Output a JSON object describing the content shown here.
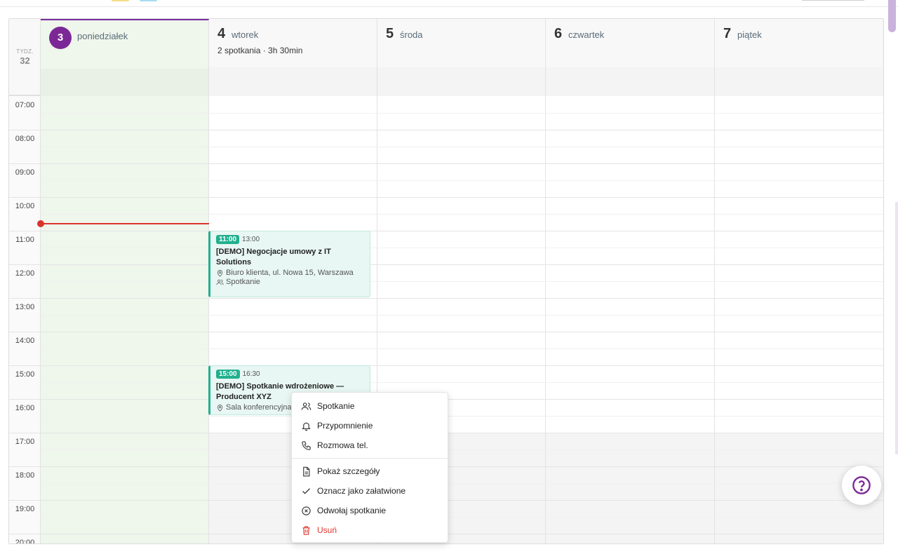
{
  "week": {
    "label": "TYDZ.",
    "number": "32"
  },
  "days": [
    {
      "num": "3",
      "name": "poniedziałek",
      "summary": ""
    },
    {
      "num": "4",
      "name": "wtorek",
      "summary": "2 spotkania · 3h 30min"
    },
    {
      "num": "5",
      "name": "środa",
      "summary": ""
    },
    {
      "num": "6",
      "name": "czwartek",
      "summary": ""
    },
    {
      "num": "7",
      "name": "piątek",
      "summary": ""
    }
  ],
  "times": [
    "07:00",
    "08:00",
    "09:00",
    "10:00",
    "11:00",
    "12:00",
    "13:00",
    "14:00",
    "15:00",
    "16:00",
    "17:00",
    "18:00",
    "19:00",
    "20:00"
  ],
  "events": [
    {
      "start": "11:00",
      "end": "13:00",
      "title": "[DEMO] Negocjacje umowy z IT Solutions",
      "location": "Biuro klienta, ul. Nowa 15, Warszawa",
      "type": "Spotkanie"
    },
    {
      "start": "15:00",
      "end": "16:30",
      "title": "[DEMO] Spotkanie wdrożeniowe — Producent XYZ",
      "location": "Sala konferencyjna"
    }
  ],
  "context_menu": {
    "items": [
      {
        "label": "Spotkanie",
        "icon": "users-icon"
      },
      {
        "label": "Przypomnienie",
        "icon": "bell-icon"
      },
      {
        "label": "Rozmowa tel.",
        "icon": "phone-icon"
      },
      {
        "label": "Pokaż szczegóły",
        "icon": "document-icon"
      },
      {
        "label": "Oznacz jako załatwione",
        "icon": "check-icon"
      },
      {
        "label": "Odwołaj spotkanie",
        "icon": "x-circle-icon"
      },
      {
        "label": "Usuń",
        "icon": "trash-icon"
      }
    ]
  },
  "colors": {
    "accent": "#7b2896",
    "event": "#22b08e",
    "now_line": "#d9342b",
    "danger": "#e0332a"
  }
}
